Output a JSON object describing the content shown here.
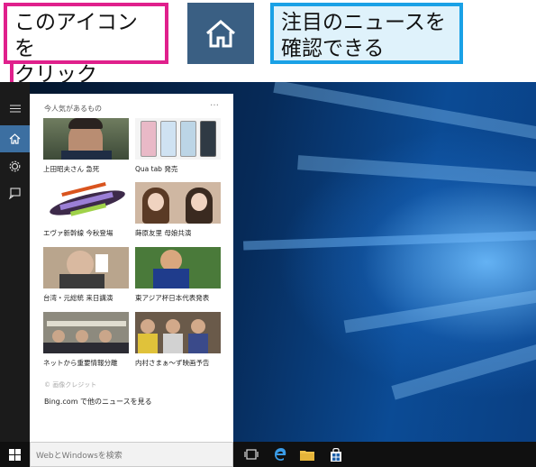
{
  "callouts": {
    "click_icon": {
      "line1": "このアイコンを",
      "line2": "クリック"
    },
    "news": {
      "line1": "注目のニュースを",
      "line2": "確認できる"
    }
  },
  "colors": {
    "pink": "#e0208c",
    "blue": "#1aa1e6",
    "accent": "#3c6fa1"
  },
  "sidebar": {
    "icons": [
      "hamburger-icon",
      "home-icon",
      "gear-icon",
      "feedback-icon"
    ]
  },
  "panel": {
    "title": "今人気があるもの",
    "more": "…",
    "items": [
      {
        "caption": "上田昭夫さん 急死"
      },
      {
        "caption": "Qua tab 発売"
      },
      {
        "caption": "エヴァ新幹線 今秋登場"
      },
      {
        "caption": "蒔原友里 母娘共演"
      },
      {
        "caption": "台湾・元総統 来日講演"
      },
      {
        "caption": "東アジア杯日本代表発表"
      },
      {
        "caption": "ネットから重要情報分離"
      },
      {
        "caption": "内村さまぁ～ず映画予告"
      }
    ],
    "credit": "© 画像クレジット",
    "bing_link": "Bing.com で他のニュースを見る"
  },
  "taskbar": {
    "search_placeholder": "WebとWindowsを検索",
    "icons": [
      "windows-icon",
      "task-view-icon",
      "edge-icon",
      "explorer-icon",
      "store-icon"
    ]
  }
}
